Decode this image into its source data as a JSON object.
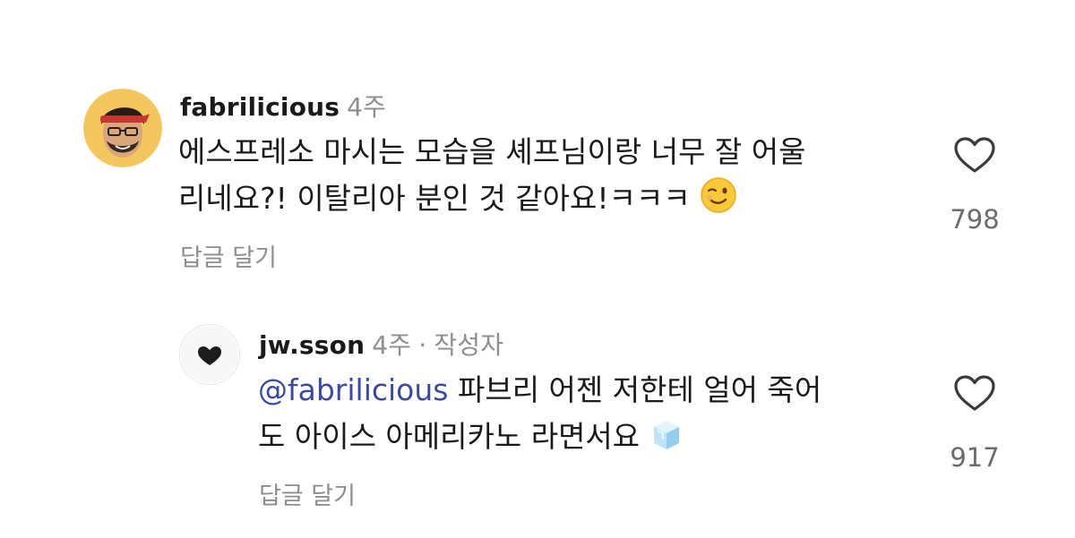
{
  "comments": [
    {
      "username": "fabrilicious",
      "time": "4주",
      "lines": [
        "에스프레소 마시는 모습을 셰프님이랑 너무 잘 어울",
        "리네요?! 이탈리아 분인 것 같아요!ㅋㅋㅋ"
      ],
      "emoji": "winking-face",
      "reply_label": "답글 달기",
      "likes": "798"
    },
    {
      "username": "jw.sson",
      "time": "4주",
      "separator": "·",
      "author_badge": "작성자",
      "mention": "@fabrilicious",
      "line1_rest": " 파브리 어젠 저한테 얼어 죽어",
      "line2": "도 아이스 아메리카노 라면서요",
      "emoji": "ice-cube",
      "reply_label": "답글 달기",
      "likes": "917"
    }
  ]
}
